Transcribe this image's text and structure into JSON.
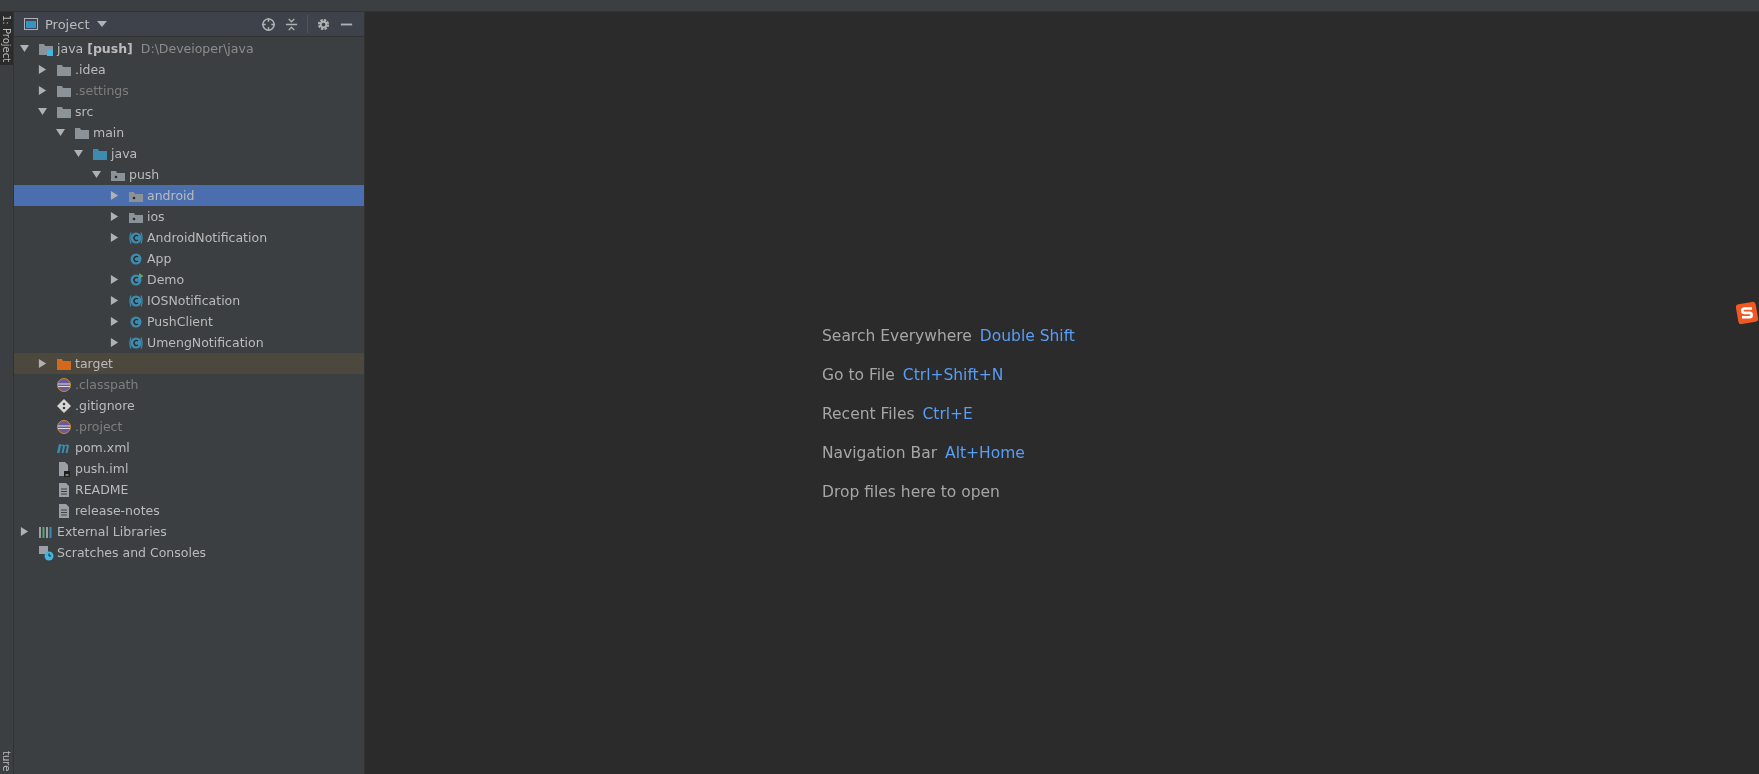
{
  "tool_strip": {
    "tabs": [
      {
        "label": "1: Project",
        "selected": true
      },
      {
        "label": "ture",
        "selected": false
      }
    ]
  },
  "project_panel": {
    "title": "Project",
    "tree": [
      {
        "label": "java **[push]**",
        "path": "D:\\Deveioper\\java",
        "kind": "module",
        "expanded": true,
        "selected": false,
        "children": [
          {
            "label": ".idea",
            "kind": "folder",
            "expanded": false,
            "selected": false
          },
          {
            "label": ".settings",
            "kind": "folder",
            "expanded": false,
            "selected": false,
            "dimmed": true
          },
          {
            "label": "src",
            "kind": "folder",
            "expanded": true,
            "selected": false,
            "children": [
              {
                "label": "main",
                "kind": "folder",
                "expanded": true,
                "selected": false,
                "children": [
                  {
                    "label": "java",
                    "kind": "source-folder",
                    "expanded": true,
                    "selected": false,
                    "children": [
                      {
                        "label": "push",
                        "kind": "package",
                        "expanded": true,
                        "selected": false,
                        "children": [
                          {
                            "label": "android",
                            "kind": "package",
                            "expanded": false,
                            "selected": true
                          },
                          {
                            "label": "ios",
                            "kind": "package",
                            "expanded": false,
                            "selected": false
                          },
                          {
                            "label": "AndroidNotification",
                            "kind": "class-nested",
                            "expanded": false,
                            "selected": false
                          },
                          {
                            "label": "App",
                            "kind": "class",
                            "selected": false
                          },
                          {
                            "label": "Demo",
                            "kind": "class-runnable",
                            "expanded": false,
                            "selected": false
                          },
                          {
                            "label": "IOSNotification",
                            "kind": "class-nested",
                            "expanded": false,
                            "selected": false
                          },
                          {
                            "label": "PushClient",
                            "kind": "class",
                            "expanded": false,
                            "selected": false
                          },
                          {
                            "label": "UmengNotification",
                            "kind": "class-nested",
                            "expanded": false,
                            "selected": false
                          }
                        ]
                      }
                    ]
                  }
                ]
              }
            ]
          },
          {
            "label": "target",
            "kind": "excluded-folder",
            "expanded": false,
            "selected": false,
            "excluded": true
          },
          {
            "label": ".classpath",
            "kind": "eclipse",
            "selected": false,
            "dimmed": true
          },
          {
            "label": ".gitignore",
            "kind": "git",
            "selected": false
          },
          {
            "label": ".project",
            "kind": "eclipse",
            "selected": false,
            "dimmed": true
          },
          {
            "label": "pom.xml",
            "kind": "maven",
            "selected": false
          },
          {
            "label": "push.iml",
            "kind": "iml",
            "selected": false
          },
          {
            "label": "README",
            "kind": "text",
            "selected": false
          },
          {
            "label": "release-notes",
            "kind": "text",
            "selected": false
          }
        ]
      },
      {
        "label": "External Libraries",
        "kind": "libraries",
        "expanded": false,
        "selected": false
      },
      {
        "label": "Scratches and Consoles",
        "kind": "scratches",
        "selected": false
      }
    ]
  },
  "editor": {
    "hints": [
      {
        "label": "Search Everywhere",
        "shortcut": "Double Shift"
      },
      {
        "label": "Go to File",
        "shortcut": "Ctrl+Shift+N"
      },
      {
        "label": "Recent Files",
        "shortcut": "Ctrl+E"
      },
      {
        "label": "Navigation Bar",
        "shortcut": "Alt+Home"
      },
      {
        "label": "Drop files here to open"
      }
    ]
  }
}
